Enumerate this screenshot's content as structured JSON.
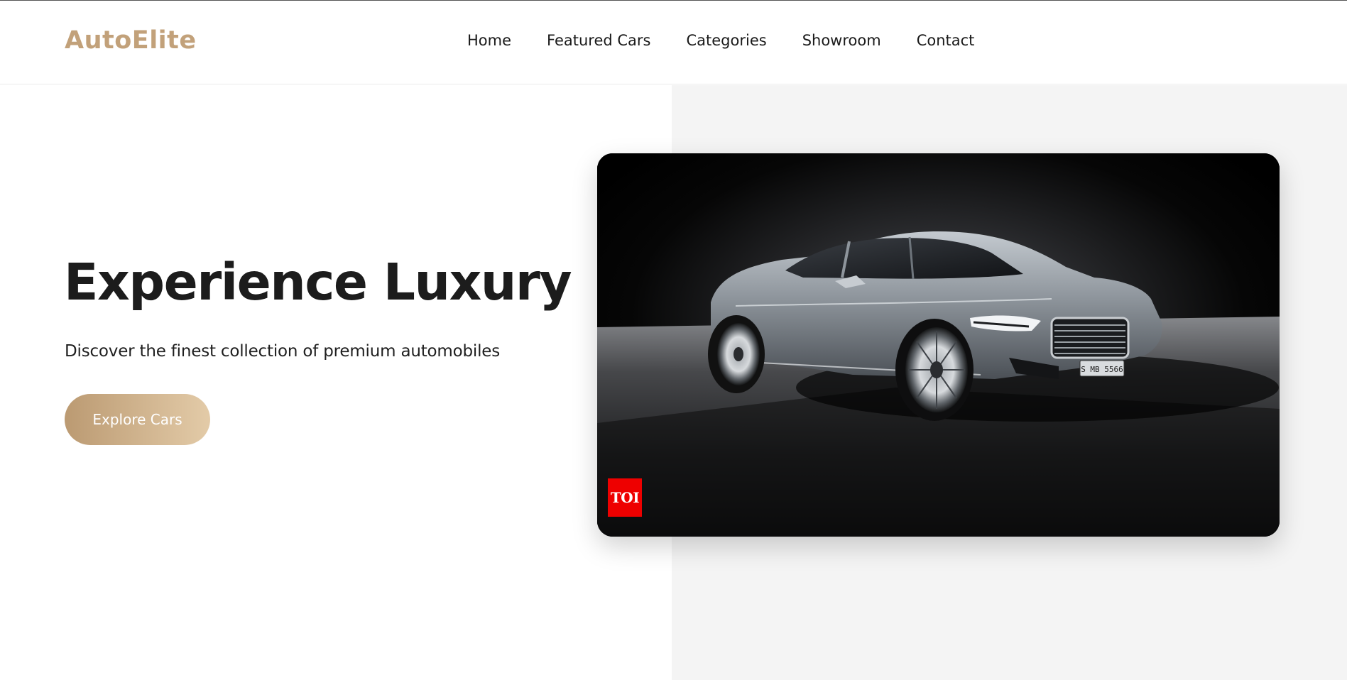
{
  "brand": {
    "name": "AutoElite",
    "color": "#c2a17a"
  },
  "nav": {
    "items": [
      {
        "label": "Home"
      },
      {
        "label": "Featured Cars"
      },
      {
        "label": "Categories"
      },
      {
        "label": "Showroom"
      },
      {
        "label": "Contact"
      }
    ]
  },
  "hero": {
    "title": "Experience Luxury",
    "subtitle": "Discover the finest collection of premium automobiles",
    "cta_label": "Explore Cars",
    "cta_gradient": [
      "#bb9a72",
      "#e3cba8"
    ],
    "right_panel_color": "#f4f4f4",
    "image": {
      "subject": "silver luxury sedan on dark studio floor",
      "plate_text": "S MB 5566",
      "badge_text": "TOI",
      "badge_color": "#ee0000"
    }
  }
}
